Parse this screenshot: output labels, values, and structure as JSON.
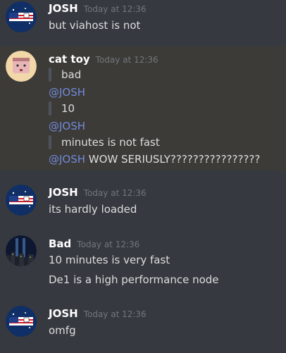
{
  "messages": [
    {
      "author": "JOSH",
      "timestamp": "Today at 12:36",
      "avatar": "flag-avatar",
      "lines": [
        "but viahost is not"
      ]
    },
    {
      "author": "cat toy",
      "timestamp": "Today at 12:36",
      "avatar": "cat-toy-avatar",
      "quote1": "bad",
      "mention1": "@JOSH",
      "quote2": "10",
      "mention2": "@JOSH",
      "quote3": "minutes is not fast",
      "mention3": "@JOSH",
      "final_text": " WOW SERIUSLY????????????????"
    },
    {
      "author": "JOSH",
      "timestamp": "Today at 12:36",
      "avatar": "flag-avatar",
      "lines": [
        "its hardly loaded"
      ]
    },
    {
      "author": "Bad",
      "timestamp": "Today at 12:36",
      "avatar": "city-night-avatar",
      "lines": [
        "10 minutes is very fast",
        "De1 is a high performance node"
      ]
    },
    {
      "author": "JOSH",
      "timestamp": "Today at 12:36",
      "avatar": "flag-avatar",
      "lines": [
        "omfg"
      ]
    }
  ],
  "colors": {
    "background": "#36393f",
    "highlight_background": "#3c3b37",
    "mention": "#7289da",
    "username": "#ffffff",
    "text": "#dcddde",
    "timestamp": "#72767d"
  }
}
